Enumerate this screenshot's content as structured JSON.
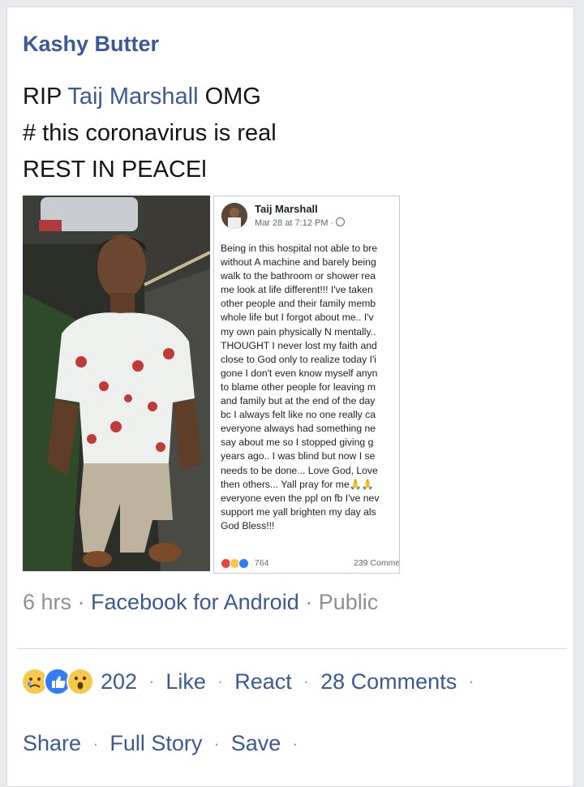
{
  "post": {
    "author": "Kashy Butter",
    "text": {
      "prefix": "RIP ",
      "mention": "Taij Marshall",
      "suffix": " OMG",
      "line2": "# this coronavirus is real",
      "line3": "REST IN PEACEl"
    },
    "meta": {
      "time": "6 hrs",
      "source": "Facebook for Android",
      "privacy": "Public"
    },
    "reactions": {
      "icons": [
        "sad-face-icon",
        "thumbs-up-icon",
        "wow-face-icon"
      ],
      "count": "202"
    },
    "actions": {
      "like": "Like",
      "react": "React",
      "comments": "28 Comments",
      "share": "Share",
      "full_story": "Full Story",
      "save": "Save"
    }
  },
  "screenshot": {
    "name": "Taij Marshall",
    "meta": "Mar 28 at 7:12 PM · ",
    "lines": [
      "Being in this hospital not able to bre",
      "without A machine and barely being",
      "walk to the bathroom or shower rea",
      "me look at life different!!! I've taken",
      "other people and their family memb",
      "whole life but I forgot about me.. I'v",
      "my own pain physically N mentally..",
      "THOUGHT I never lost my faith and",
      "close to God only to realize today I'i",
      "gone I don't even know myself anyn",
      "to blame other people for leaving m",
      "and family but at the end of the day",
      "bc I always felt like no one really ca",
      "everyone always had something ne",
      "say about me so I stopped giving g",
      "years ago.. I was blind but now I se",
      "needs to be done... Love God, Love",
      "then others... Yall pray for me🙏🙏",
      "everyone even the ppl on fb I've nev",
      "support me yall brighten my day als",
      "God Bless!!!"
    ],
    "reaction_count": "764",
    "comments": "239 Comme"
  },
  "colors": {
    "link": "#3b5998",
    "meta_gray": "#8d8f93",
    "text": "#141414"
  }
}
